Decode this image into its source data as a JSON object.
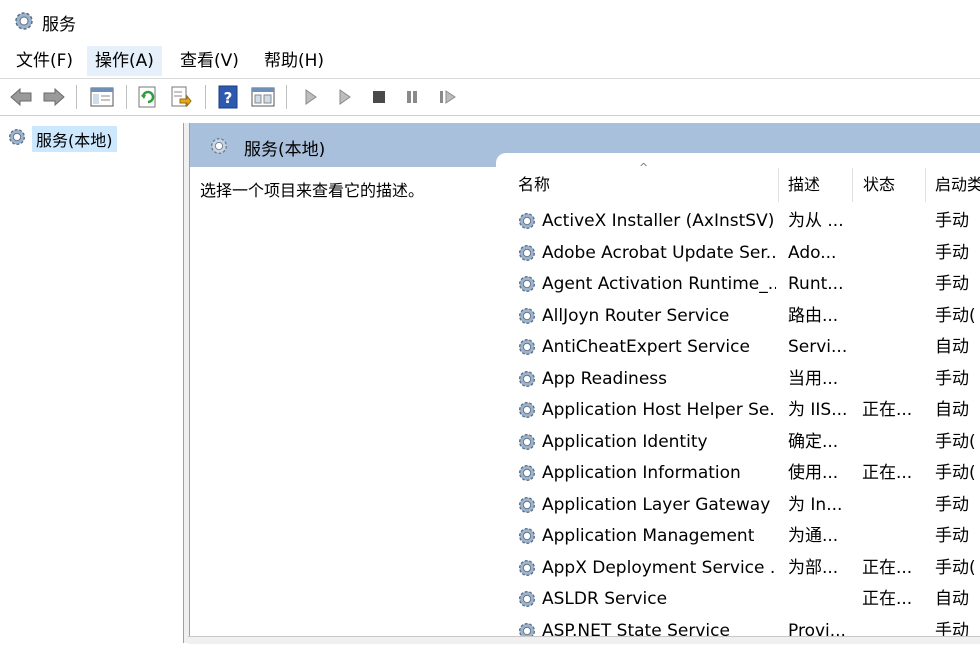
{
  "window": {
    "title": "服务"
  },
  "menu": [
    {
      "label": "文件(F)"
    },
    {
      "label": "操作(A)"
    },
    {
      "label": "查看(V)"
    },
    {
      "label": "帮助(H)"
    }
  ],
  "toolbar": {
    "icons": [
      "back-arrow-icon",
      "forward-arrow-icon",
      "show-hide-console-tree-icon",
      "refresh-icon",
      "export-list-icon",
      "help-icon",
      "properties-icon",
      "start-service-icon",
      "start-service-alt-icon",
      "stop-service-icon",
      "pause-service-icon",
      "resume-service-icon"
    ]
  },
  "tree": {
    "root_label": "服务(本地)"
  },
  "pane": {
    "header": "服务(本地)",
    "description_hint": "选择一个项目来查看它的描述。"
  },
  "columns": {
    "name": "名称",
    "desc": "描述",
    "status": "状态",
    "startup": "启动类"
  },
  "services": [
    {
      "name": "ActiveX Installer (AxInstSV)",
      "desc": "为从 ...",
      "status": "",
      "startup": "手动"
    },
    {
      "name": "Adobe Acrobat Update Ser...",
      "desc": "Ado...",
      "status": "",
      "startup": "手动"
    },
    {
      "name": "Agent Activation Runtime_...",
      "desc": "Runt...",
      "status": "",
      "startup": "手动"
    },
    {
      "name": "AllJoyn Router Service",
      "desc": "路由...",
      "status": "",
      "startup": "手动("
    },
    {
      "name": "AntiCheatExpert Service",
      "desc": "Servi...",
      "status": "",
      "startup": "自动"
    },
    {
      "name": "App Readiness",
      "desc": "当用...",
      "status": "",
      "startup": "手动"
    },
    {
      "name": "Application Host Helper Se...",
      "desc": "为 IIS...",
      "status": "正在...",
      "startup": "自动"
    },
    {
      "name": "Application Identity",
      "desc": "确定...",
      "status": "",
      "startup": "手动("
    },
    {
      "name": "Application Information",
      "desc": "使用...",
      "status": "正在...",
      "startup": "手动("
    },
    {
      "name": "Application Layer Gateway ...",
      "desc": "为 In...",
      "status": "",
      "startup": "手动"
    },
    {
      "name": "Application Management",
      "desc": "为通...",
      "status": "",
      "startup": "手动"
    },
    {
      "name": "AppX Deployment Service ...",
      "desc": "为部...",
      "status": "正在...",
      "startup": "手动("
    },
    {
      "name": "ASLDR Service",
      "desc": "",
      "status": "正在...",
      "startup": "自动"
    },
    {
      "name": "ASP.NET State Service",
      "desc": "Provi...",
      "status": "",
      "startup": "手动"
    }
  ],
  "colors": {
    "header_band": "#a8c0dc",
    "selection": "#cce8ff",
    "menu_active": "#e5f0fa"
  }
}
